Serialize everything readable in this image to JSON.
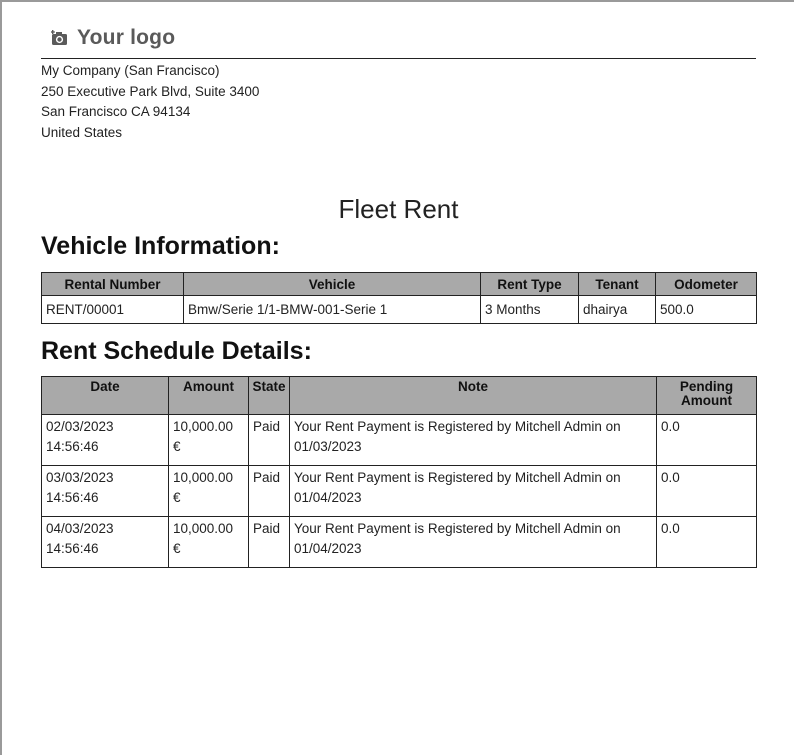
{
  "logo": {
    "text": "Your logo",
    "icon": "camera-plus-icon"
  },
  "company": {
    "name": "My Company (San Francisco)",
    "street": "250 Executive Park Blvd, Suite 3400",
    "city_line": "San Francisco CA 94134",
    "country": "United States"
  },
  "document_title": "Fleet Rent",
  "vehicle_section": {
    "heading": "Vehicle Information:",
    "headers": [
      "Rental Number",
      "Vehicle",
      "Rent Type",
      "Tenant",
      "Odometer"
    ],
    "row": {
      "rental_number": "RENT/00001",
      "vehicle": "Bmw/Serie 1/1-BMW-001-Serie 1",
      "rent_type": "3 Months",
      "tenant": "dhairya",
      "odometer": "500.0"
    }
  },
  "schedule_section": {
    "heading": "Rent Schedule Details:",
    "headers": {
      "date": "Date",
      "amount": "Amount",
      "state": "State",
      "note": "Note",
      "pending_line1": "Pending",
      "pending_line2": "Amount"
    },
    "rows": [
      {
        "date": "02/03/2023",
        "time": "14:56:46",
        "amount": "10,000.00 €",
        "state": "Paid",
        "note": "Your Rent Payment is Registered by Mitchell Admin on 01/03/2023",
        "pending": "0.0"
      },
      {
        "date": "03/03/2023",
        "time": "14:56:46",
        "amount": "10,000.00 €",
        "state": "Paid",
        "note": "Your Rent Payment is Registered by Mitchell Admin on 01/04/2023",
        "pending": "0.0"
      },
      {
        "date": "04/03/2023",
        "time": "14:56:46",
        "amount": "10,000.00 €",
        "state": "Paid",
        "note": "Your Rent Payment is Registered by Mitchell Admin on 01/04/2023",
        "pending": "0.0"
      }
    ]
  }
}
